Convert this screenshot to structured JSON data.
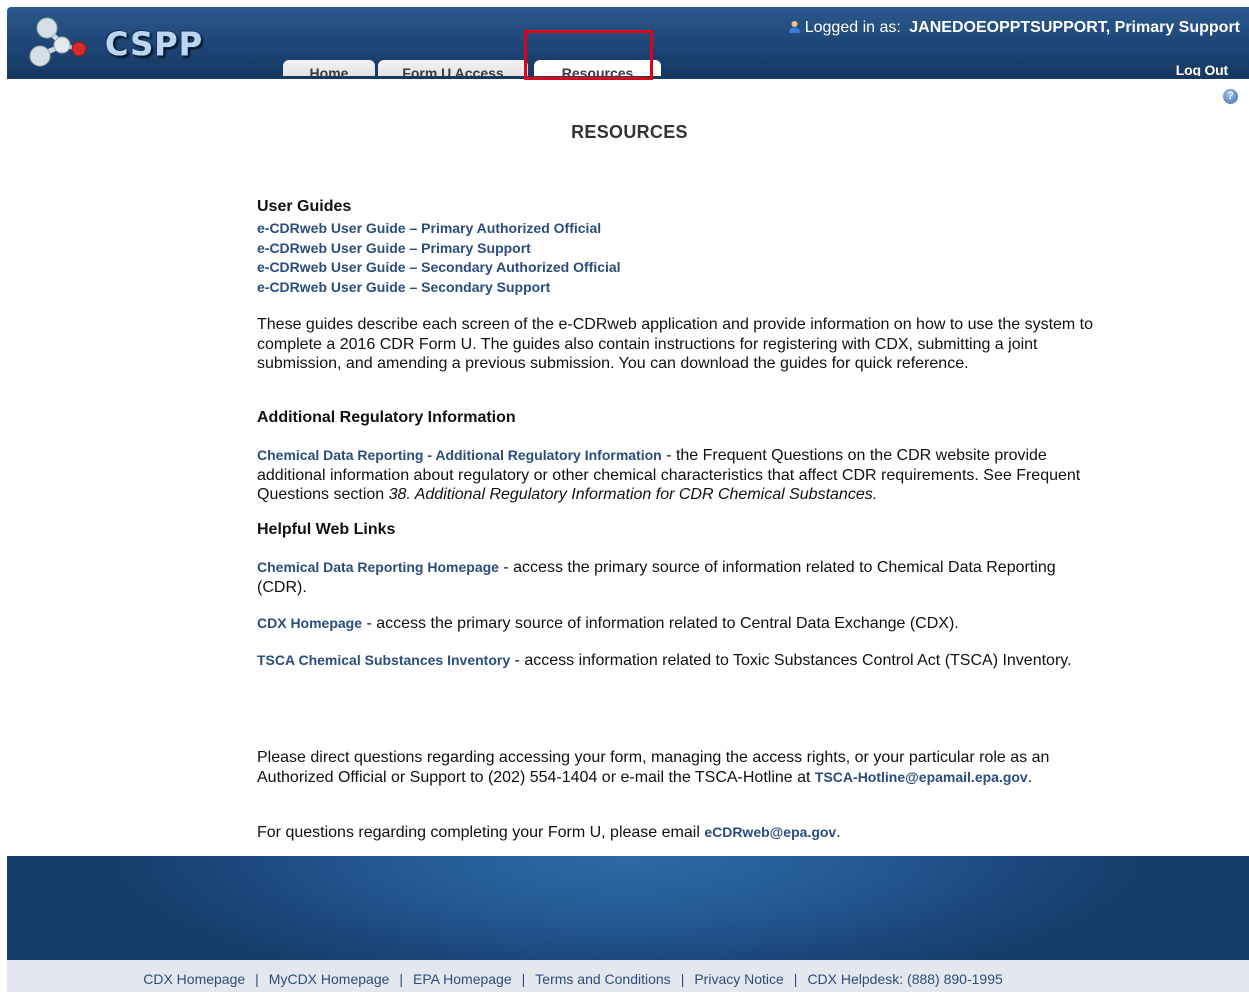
{
  "header": {
    "logo_text": "CSPP",
    "logged_in_prefix": "Logged in as:",
    "logged_in_user": "JANEDOEOPPTSUPPORT, Primary Support",
    "logout": "Log Out",
    "tabs": [
      {
        "label": "Home"
      },
      {
        "label": "Form U Access"
      },
      {
        "label": "Resources"
      }
    ],
    "highlight_color": "#e1001a"
  },
  "page": {
    "title": "RESOURCES",
    "user_guides": {
      "heading": "User Guides",
      "links": [
        "e-CDRweb User Guide – Primary Authorized Official",
        "e-CDRweb User Guide – Primary Support",
        "e-CDRweb User Guide – Secondary Authorized Official",
        "e-CDRweb User Guide – Secondary Support"
      ],
      "description": "These guides describe each screen of the e-CDRweb application and provide information on how to use the system to complete a 2016 CDR Form U. The guides also contain instructions for registering with CDX, submitting a joint submission, and amending a previous submission. You can download the guides for quick reference."
    },
    "regulatory": {
      "heading": "Additional Regulatory Information",
      "link": "Chemical Data Reporting - Additional Regulatory Information",
      "text": " - the Frequent Questions on the CDR website provide additional information about regulatory or other chemical characteristics that affect CDR requirements. See Frequent Questions section ",
      "italic": "38. Additional Regulatory Information for CDR Chemical Substances."
    },
    "helpful": {
      "heading": "Helpful Web Links",
      "items": [
        {
          "link": "Chemical Data Reporting Homepage",
          "text": " - access the primary source of information related to Chemical Data Reporting (CDR)."
        },
        {
          "link": "CDX Homepage",
          "text": " - access the primary source of information related to Central Data Exchange (CDX)."
        },
        {
          "link": "TSCA Chemical Substances Inventory",
          "text": " - access information related to Toxic Substances Control Act (TSCA) Inventory."
        }
      ]
    },
    "contact": {
      "text": "Please direct questions regarding accessing your form, managing the access rights, or your particular role as an Authorized Official or Support to (202) 554-1404 or e-mail the TSCA-Hotline at ",
      "email": "TSCA-Hotline@epamail.epa.gov",
      "end": "."
    },
    "form_u": {
      "text": "For questions regarding completing your Form U, please email ",
      "email": "eCDRweb@epa.gov",
      "end": "."
    }
  },
  "footer": {
    "links": [
      "CDX Homepage",
      "MyCDX Homepage",
      "EPA Homepage",
      "Terms and Conditions",
      "Privacy Notice"
    ],
    "helpdesk": "CDX Helpdesk: (888) 890-1995",
    "separator": "|"
  }
}
